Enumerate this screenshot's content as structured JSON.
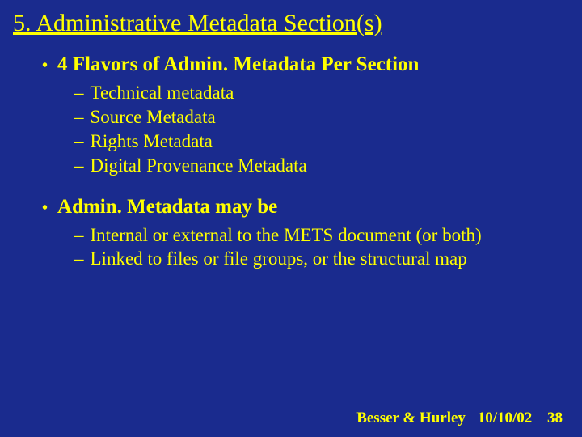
{
  "title": "5. Administrative Metadata Section(s)",
  "bullets": [
    {
      "heading": "4 Flavors of Admin. Metadata Per Section",
      "subs": [
        "Technical metadata",
        "Source Metadata",
        "Rights Metadata",
        "Digital Provenance Metadata"
      ]
    },
    {
      "heading": "Admin. Metadata may be",
      "subs": [
        "Internal or external to the METS document (or both)",
        "Linked to files or file groups, or the structural map"
      ]
    }
  ],
  "footer": {
    "author": "Besser & Hurley",
    "date": "10/10/02",
    "page": "38"
  }
}
